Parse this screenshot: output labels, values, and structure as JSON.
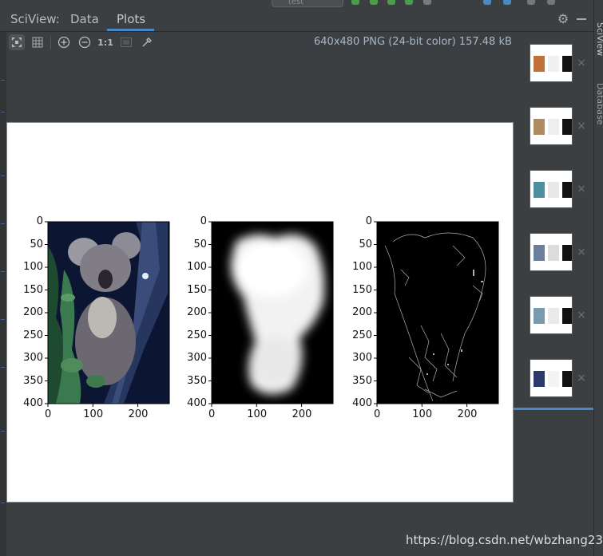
{
  "header": {
    "tool_title": "SciView:",
    "tabs": [
      {
        "label": "Data",
        "active": false
      },
      {
        "label": "Plots",
        "active": true
      }
    ],
    "peek_text": "test"
  },
  "toolbar": {
    "image_info": "640x480 PNG (24-bit color) 157.48 kB",
    "actual_size_label": "1:1",
    "buttons": [
      "fit-zoom-icon",
      "grid-icon",
      "zoom-in-icon",
      "zoom-out-icon",
      "actual-size",
      "background-icon",
      "color-picker-icon"
    ]
  },
  "plot": {
    "subplots": [
      {
        "name": "koala-original"
      },
      {
        "name": "koala-saliency"
      },
      {
        "name": "koala-edges"
      }
    ],
    "y_ticks": [
      "0",
      "50",
      "100",
      "150",
      "200",
      "250",
      "300",
      "350",
      "400"
    ],
    "x_ticks": [
      "0",
      "100",
      "200"
    ]
  },
  "thumbnails": [
    {
      "name": "thumb-1"
    },
    {
      "name": "thumb-2"
    },
    {
      "name": "thumb-3"
    },
    {
      "name": "thumb-4"
    },
    {
      "name": "thumb-5"
    },
    {
      "name": "thumb-6"
    }
  ],
  "side_labels": {
    "sciview": "SciView",
    "database": "Database"
  },
  "watermark": "https://blog.csdn.net/wbzhang233",
  "colors": {
    "accent": "#4a88c7",
    "background": "#3c3f41"
  }
}
